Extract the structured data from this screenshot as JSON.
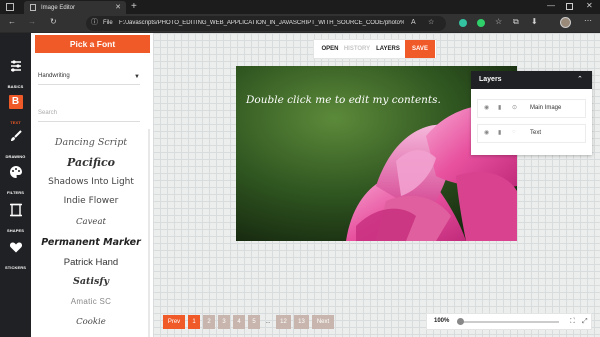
{
  "browser": {
    "tab_title": "Image Editor",
    "new_tab": "+",
    "url_prefix": "File",
    "url": "F:/Javascripts/PHOTO_EDITING_WEB_APPLICATION_IN_JAVASCRIPT_WITH_SOURCE_CODE/photo%20editing..."
  },
  "toolrail": {
    "items": [
      {
        "label": "BASICS",
        "icon": "sliders-icon"
      },
      {
        "label": "TEXT",
        "icon": "text-b-icon"
      },
      {
        "label": "DRAWING",
        "icon": "brush-icon"
      },
      {
        "label": "FILTERS",
        "icon": "palette-icon"
      },
      {
        "label": "SHAPES",
        "icon": "shapes-icon"
      },
      {
        "label": "STICKERS",
        "icon": "heart-icon"
      }
    ]
  },
  "textpanel": {
    "header": "Pick a Font",
    "category": "Handwriting",
    "search_placeholder": "Search",
    "fonts": [
      "Dancing Script",
      "Pacifico",
      "Shadows Into Light",
      "Indie Flower",
      "Caveat",
      "Permanent Marker",
      "Patrick Hand",
      "Satisfy",
      "Amatic SC",
      "Cookie"
    ]
  },
  "topbar": {
    "open": "OPEN",
    "history": "HISTORY",
    "layers": "LAYERS",
    "save": "SAVE"
  },
  "canvas": {
    "overlay_text": "Double click me to edit my contents."
  },
  "layers": {
    "title": "Layers",
    "rows": [
      {
        "label": "Main Image"
      },
      {
        "label": "Text"
      }
    ]
  },
  "pager": {
    "prev": "Prev",
    "pages": [
      "1",
      "2",
      "3",
      "4",
      "5"
    ],
    "ellipsis": "...",
    "pages_end": [
      "12",
      "13"
    ],
    "next": "Next"
  },
  "zoom": {
    "value": "100%",
    "level": 0.0
  },
  "colors": {
    "accent": "#f05a28",
    "rail": "#202124",
    "page_muted": "#c8b6ae"
  }
}
